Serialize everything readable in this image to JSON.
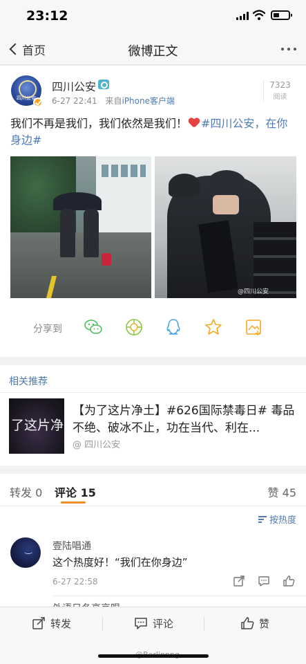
{
  "status_bar": {
    "time": "23:12"
  },
  "nav": {
    "back_label": "首页",
    "title": "微博正文"
  },
  "post": {
    "author": "四川公安",
    "avatar_text": "四川公安",
    "date": "6-27 22:41",
    "source_prefix": "来自",
    "source": "iPhone客户端",
    "read_count": "7323",
    "read_label": "阅读",
    "text": "我们不再是我们，我们依然是我们！",
    "hashtag": "#四川公安，在你身边#",
    "photo_watermark": "@四川公安"
  },
  "share": {
    "label": "分享到",
    "targets": [
      "wechat-icon",
      "moments-icon",
      "qq-icon",
      "favorite-icon",
      "save-image-icon"
    ]
  },
  "recommendations": {
    "title": "相关推荐",
    "items": [
      {
        "thumb_text": "了这片净",
        "title": "【为了这片净土】#626国际禁毒日# 毒品不绝、破冰不止，功在当代、利在...",
        "source": "@ 四川公安"
      }
    ]
  },
  "tabs": {
    "repost": "转发 0",
    "comments": "评论 15",
    "likes": "赞 45",
    "sort_label": "按热度"
  },
  "comments": [
    {
      "user": "壹陆唱通",
      "text": "这个热度好！“我们在你身边”",
      "time": "6-27 22:58"
    },
    {
      "user": "外语日冬高京唱"
    }
  ],
  "bottom_bar": {
    "repost": "转发",
    "comment": "评论",
    "like": "赞",
    "watermark": "@Berlinnng"
  },
  "colors": {
    "link_blue": "#4f7ab3",
    "accent_orange": "#f28c28",
    "heart_red": "#e64340"
  }
}
